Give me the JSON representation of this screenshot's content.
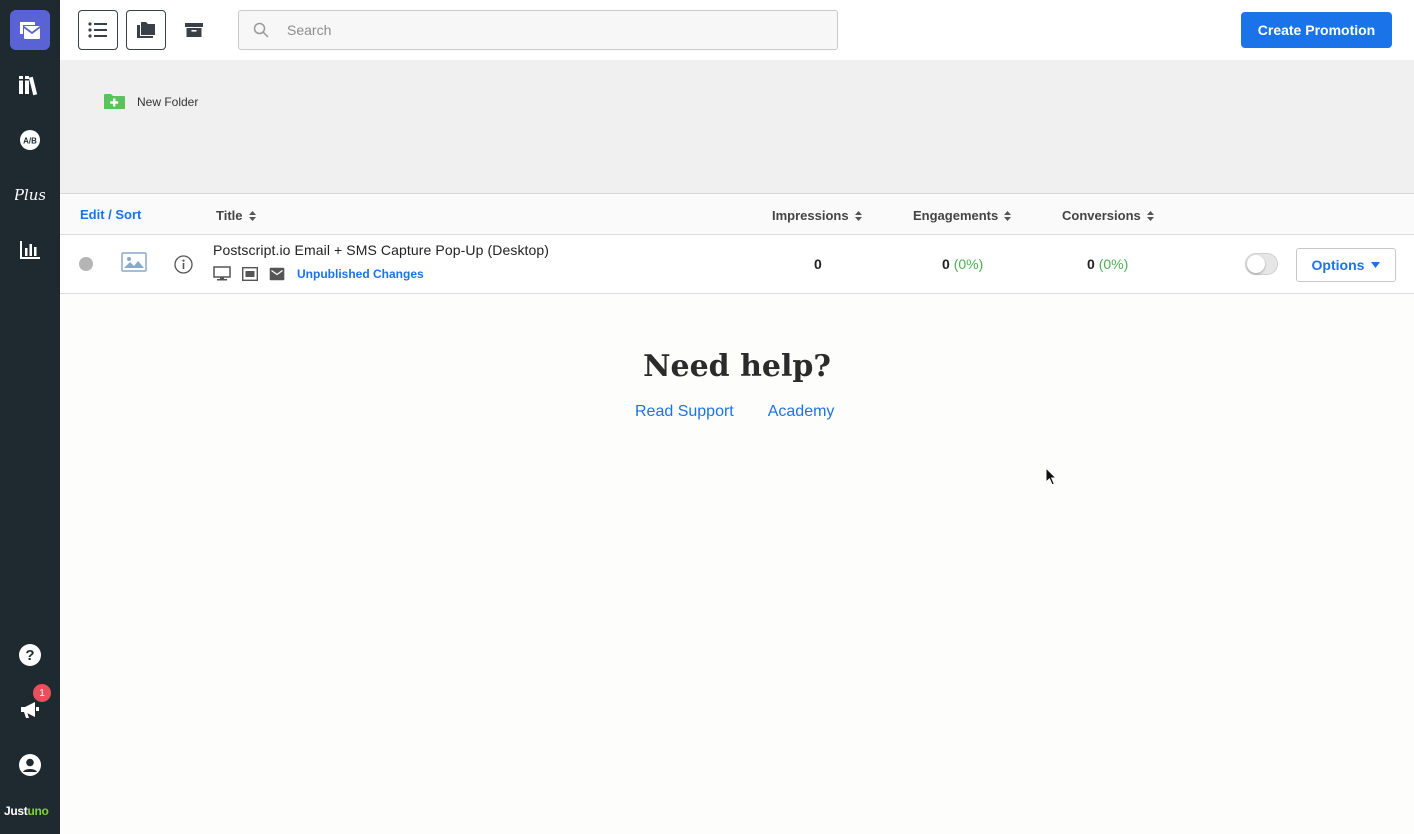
{
  "sidebar": {
    "items": [
      {
        "icon": "promotions-icon",
        "active": true
      },
      {
        "icon": "library-icon"
      },
      {
        "icon": "ab-test-icon",
        "label": "A/B"
      },
      {
        "icon": "plus-icon",
        "label": "Plus"
      },
      {
        "icon": "analytics-icon"
      }
    ],
    "bottom": [
      {
        "icon": "help-icon"
      },
      {
        "icon": "announcements-icon",
        "badge": "1"
      },
      {
        "icon": "account-icon"
      }
    ],
    "logo": {
      "part1": "Just",
      "part2": "uno"
    }
  },
  "toolbar": {
    "view_buttons": [
      "list-view-icon",
      "folder-view-icon",
      "archive-icon"
    ],
    "search_placeholder": "Search",
    "create_label": "Create Promotion"
  },
  "folders": {
    "new_folder_label": "New Folder"
  },
  "table": {
    "headers": {
      "edit_sort": "Edit / Sort",
      "title": "Title",
      "impressions": "Impressions",
      "engagements": "Engagements",
      "conversions": "Conversions"
    },
    "rows": [
      {
        "title": "Postscript.io Email + SMS Capture Pop-Up (Desktop)",
        "status": "Unpublished Changes",
        "impressions": "0",
        "engagements": "0",
        "engagements_pct": "(0%)",
        "conversions": "0",
        "conversions_pct": "(0%)",
        "enabled": false,
        "options_label": "Options"
      }
    ]
  },
  "help": {
    "title": "Need help?",
    "links": [
      "Read Support",
      "Academy"
    ]
  },
  "colors": {
    "sidebar_bg": "#1f2a30",
    "accent": "#1a73e8",
    "active_nav": "#5a63d6",
    "positive": "#4caf50",
    "badge": "#e8505b"
  }
}
